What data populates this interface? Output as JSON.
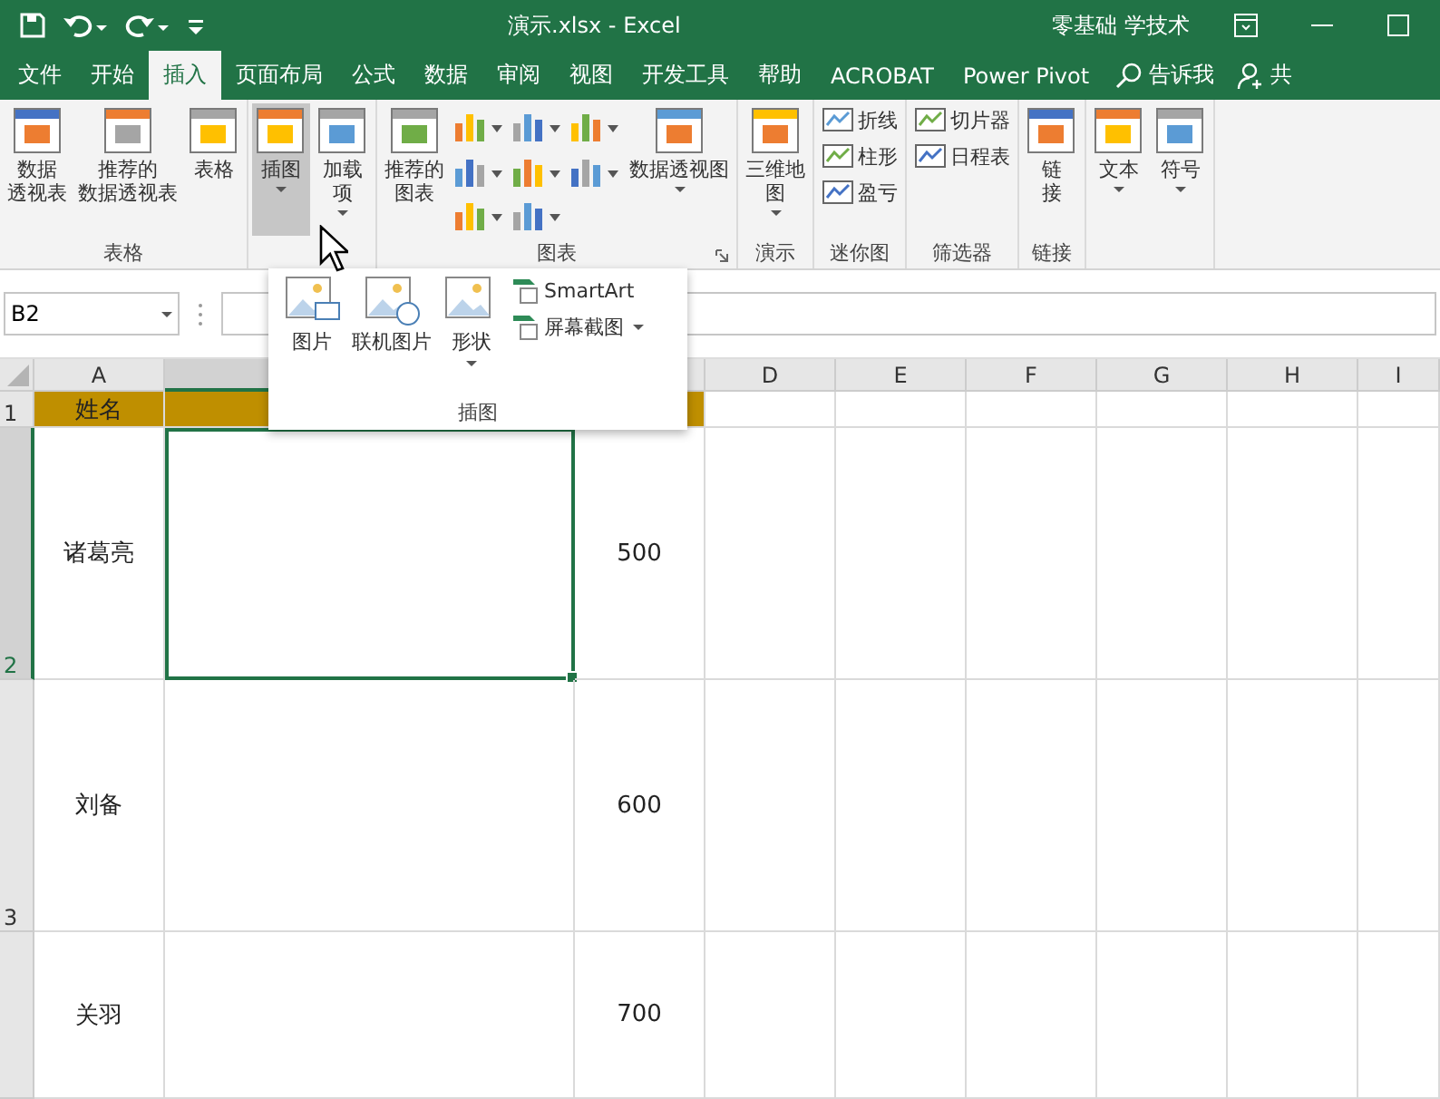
{
  "title_bar": {
    "title": "演示.xlsx  -  Excel",
    "user": "零基础 学技术"
  },
  "tabs": [
    {
      "label": "文件",
      "selected": false
    },
    {
      "label": "开始",
      "selected": false
    },
    {
      "label": "插入",
      "selected": true
    },
    {
      "label": "页面布局",
      "selected": false
    },
    {
      "label": "公式",
      "selected": false
    },
    {
      "label": "数据",
      "selected": false
    },
    {
      "label": "审阅",
      "selected": false
    },
    {
      "label": "视图",
      "selected": false
    },
    {
      "label": "开发工具",
      "selected": false
    },
    {
      "label": "帮助",
      "selected": false
    },
    {
      "label": "ACROBAT",
      "selected": false
    },
    {
      "label": "Power Pivot",
      "selected": false
    }
  ],
  "tell_me": "告诉我",
  "share": "共",
  "ribbon_groups": [
    {
      "label": "表格",
      "items": [
        {
          "kind": "large",
          "lines": [
            "数据",
            "透视表"
          ],
          "dropdown": false,
          "selected": false
        },
        {
          "kind": "large",
          "lines": [
            "推荐的",
            "数据透视表"
          ],
          "dropdown": false,
          "selected": false
        },
        {
          "kind": "large",
          "lines": [
            "表格"
          ],
          "dropdown": false,
          "selected": false
        }
      ]
    },
    {
      "items": [
        {
          "kind": "large",
          "lines": [
            "插图"
          ],
          "dropdown": true,
          "selected": true
        },
        {
          "kind": "large",
          "lines": [
            "加载",
            "项"
          ],
          "dropdown": true,
          "selected": false
        }
      ]
    },
    {
      "label": "图表",
      "launcher": true,
      "items": [
        {
          "kind": "large",
          "lines": [
            "推荐的",
            "图表"
          ],
          "dropdown": false,
          "selected": false
        },
        {
          "kind": "chart_grid"
        },
        {
          "kind": "large",
          "lines": [
            "数据透视图"
          ],
          "dropdown": true,
          "selected": false
        }
      ]
    },
    {
      "label": "演示",
      "items": [
        {
          "kind": "large",
          "lines": [
            "三维地",
            "图"
          ],
          "dropdown": true,
          "selected": false
        }
      ]
    },
    {
      "label": "迷你图",
      "items": [
        {
          "kind": "stack",
          "buttons": [
            {
              "label": "折线",
              "dropdown": false
            },
            {
              "label": "柱形",
              "dropdown": false
            },
            {
              "label": "盈亏",
              "dropdown": false
            }
          ]
        }
      ]
    },
    {
      "label": "筛选器",
      "items": [
        {
          "kind": "stack",
          "buttons": [
            {
              "label": "切片器",
              "dropdown": false
            },
            {
              "label": "日程表",
              "dropdown": false
            }
          ]
        }
      ]
    },
    {
      "label": "链接",
      "items": [
        {
          "kind": "large",
          "lines": [
            "链",
            "接"
          ],
          "dropdown": false,
          "selected": false
        }
      ]
    },
    {
      "items": [
        {
          "kind": "large",
          "lines": [
            "文本"
          ],
          "dropdown": true,
          "selected": false
        },
        {
          "kind": "large",
          "lines": [
            "符号"
          ],
          "dropdown": true,
          "selected": false
        }
      ]
    }
  ],
  "popup": {
    "label": "插图",
    "large": [
      {
        "label": "图片",
        "dropdown": false
      },
      {
        "label": "联机图片",
        "dropdown": false
      },
      {
        "label": "形状",
        "dropdown": true
      }
    ],
    "small": [
      {
        "label": "SmartArt",
        "dropdown": false
      },
      {
        "label": "屏幕截图",
        "dropdown": true
      }
    ]
  },
  "name_box": "B2",
  "sheet": {
    "columns": [
      {
        "label": "A"
      },
      {},
      {},
      {
        "label": "D"
      },
      {
        "label": "E"
      },
      {
        "label": "F"
      },
      {
        "label": "G"
      },
      {
        "label": "H"
      },
      {
        "label": "I"
      }
    ],
    "rows": [
      {
        "header": "1",
        "kind": "header",
        "cells": [
          {
            "text": "姓名",
            "selected": false
          },
          {
            "selected": false
          },
          {
            "selected": false
          }
        ]
      },
      {
        "header": "2",
        "kind": "data",
        "cells": [
          {
            "text": "诸葛亮",
            "selected": false
          },
          {
            "selected": true
          },
          {
            "text": "500",
            "selected": false
          }
        ]
      },
      {
        "header": "3",
        "kind": "data",
        "cells": [
          {
            "text": "刘备",
            "selected": false
          },
          {
            "selected": false
          },
          {
            "text": "600",
            "selected": false
          }
        ]
      },
      {
        "kind": "data",
        "cells": [
          {
            "text": "关羽",
            "selected": false
          },
          {
            "selected": false
          },
          {
            "text": "700",
            "selected": false
          }
        ]
      }
    ]
  }
}
